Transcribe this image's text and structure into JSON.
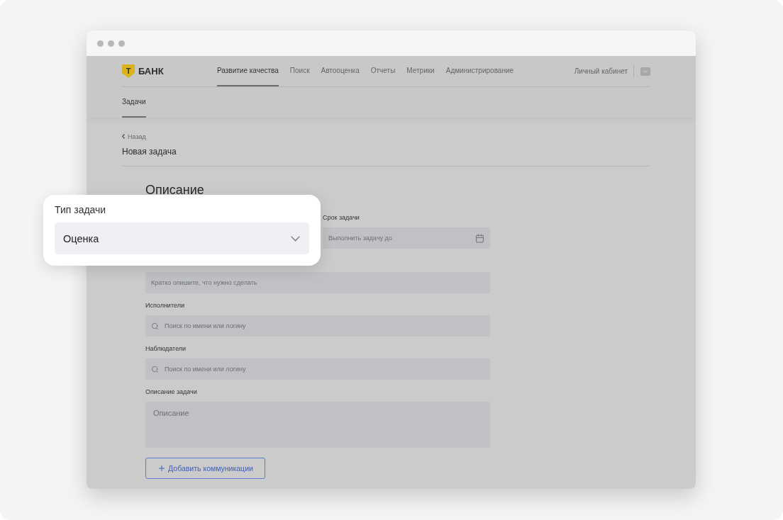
{
  "brand": {
    "mark": "Т",
    "name": "БАНК"
  },
  "nav": [
    {
      "label": "Развитие качества",
      "selected": true
    },
    {
      "label": "Поиск",
      "selected": false
    },
    {
      "label": "Автооценка",
      "selected": false
    },
    {
      "label": "Отчеты",
      "selected": false
    },
    {
      "label": "Метрики",
      "selected": false
    },
    {
      "label": "Администрирование",
      "selected": false
    }
  ],
  "account": "Личный кабинет",
  "subtabs": [
    {
      "label": "Задачи",
      "selected": true
    }
  ],
  "back": "Назад",
  "page_title": "Новая задача",
  "form": {
    "heading": "Описание",
    "deadline": {
      "label": "Срок задачи",
      "placeholder": "Выполнить задачу до"
    },
    "summary": {
      "placeholder": "Кратко опишите, что нужно сделать"
    },
    "assignees": {
      "label": "Исполнители",
      "placeholder": "Поиск по имени или логину"
    },
    "observers": {
      "label": "Наблюдатели",
      "placeholder": "Поиск по имени или логину"
    },
    "description": {
      "label": "Описание задачи",
      "placeholder": "Описание"
    },
    "add_button": "Добавить коммуникации"
  },
  "popout": {
    "label": "Тип задачи",
    "value": "Оценка"
  }
}
